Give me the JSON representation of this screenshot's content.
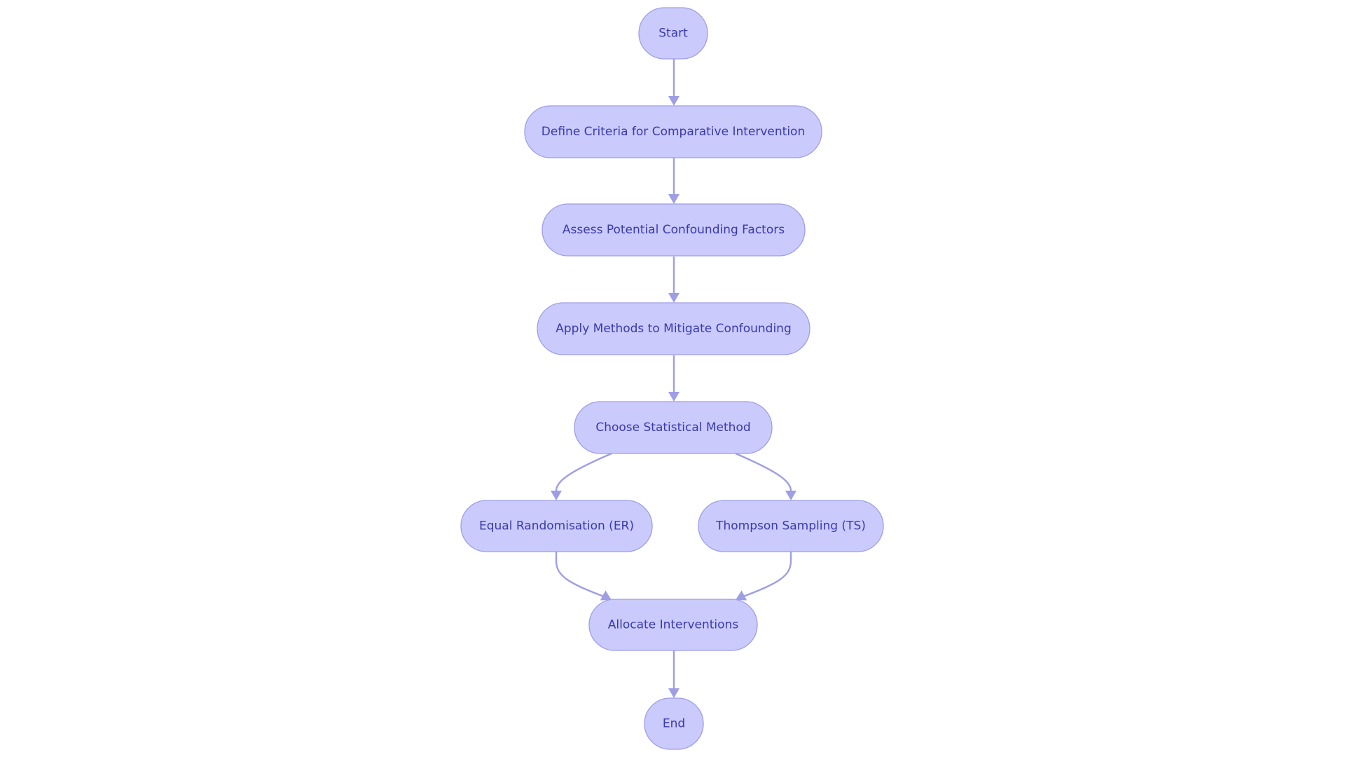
{
  "diagram": {
    "type": "flowchart",
    "direction": "top-down",
    "colors": {
      "node_fill": "#cacafc",
      "node_stroke": "#9e9ee6",
      "text": "#3a3aae",
      "edge": "#9e9ee6"
    },
    "nodes": [
      {
        "id": "start",
        "label": "Start"
      },
      {
        "id": "define",
        "label": "Define Criteria for Comparative Intervention"
      },
      {
        "id": "assess",
        "label": "Assess Potential Confounding Factors"
      },
      {
        "id": "apply",
        "label": "Apply Methods to Mitigate Confounding"
      },
      {
        "id": "choose",
        "label": "Choose Statistical Method"
      },
      {
        "id": "er",
        "label": "Equal Randomisation (ER)"
      },
      {
        "id": "ts",
        "label": "Thompson Sampling (TS)"
      },
      {
        "id": "allocate",
        "label": "Allocate Interventions"
      },
      {
        "id": "end",
        "label": "End"
      }
    ],
    "edges": [
      {
        "from": "start",
        "to": "define"
      },
      {
        "from": "define",
        "to": "assess"
      },
      {
        "from": "assess",
        "to": "apply"
      },
      {
        "from": "apply",
        "to": "choose"
      },
      {
        "from": "choose",
        "to": "er"
      },
      {
        "from": "choose",
        "to": "ts"
      },
      {
        "from": "er",
        "to": "allocate"
      },
      {
        "from": "ts",
        "to": "allocate"
      },
      {
        "from": "allocate",
        "to": "end"
      }
    ]
  }
}
